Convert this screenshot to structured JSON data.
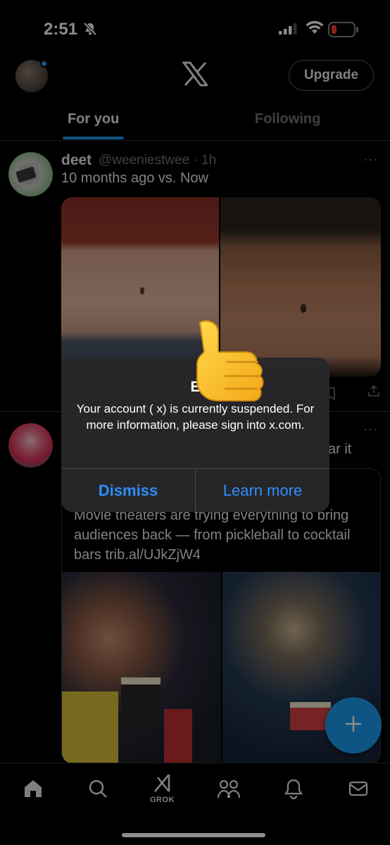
{
  "status_bar": {
    "time": "2:51"
  },
  "header": {
    "upgrade_label": "Upgrade",
    "tabs": [
      {
        "label": "For you",
        "active": true
      },
      {
        "label": "Following",
        "active": false
      }
    ]
  },
  "tweet1": {
    "name": "deet",
    "handle": "@weeniestwee · 1h",
    "text": "10 months ago vs. Now",
    "more": "···"
  },
  "tweet2": {
    "more": "···",
    "text_fragment": "ar it",
    "card_text": "Movie theaters are trying everything to bring audiences back — from pickleball to cocktail bars trib.al/UJkZjW4"
  },
  "alert": {
    "title": "E",
    "message": "Your account (                    x) is currently suspended. For more information, please sign into x.com.",
    "dismiss_label": "Dismiss",
    "learn_more_label": "Learn more"
  },
  "bottom_nav": {
    "grok_label": "GROK"
  },
  "colors": {
    "accent": "#1d9bf0",
    "alert_button": "#2e8dff",
    "battery_low": "#ff3b30"
  }
}
